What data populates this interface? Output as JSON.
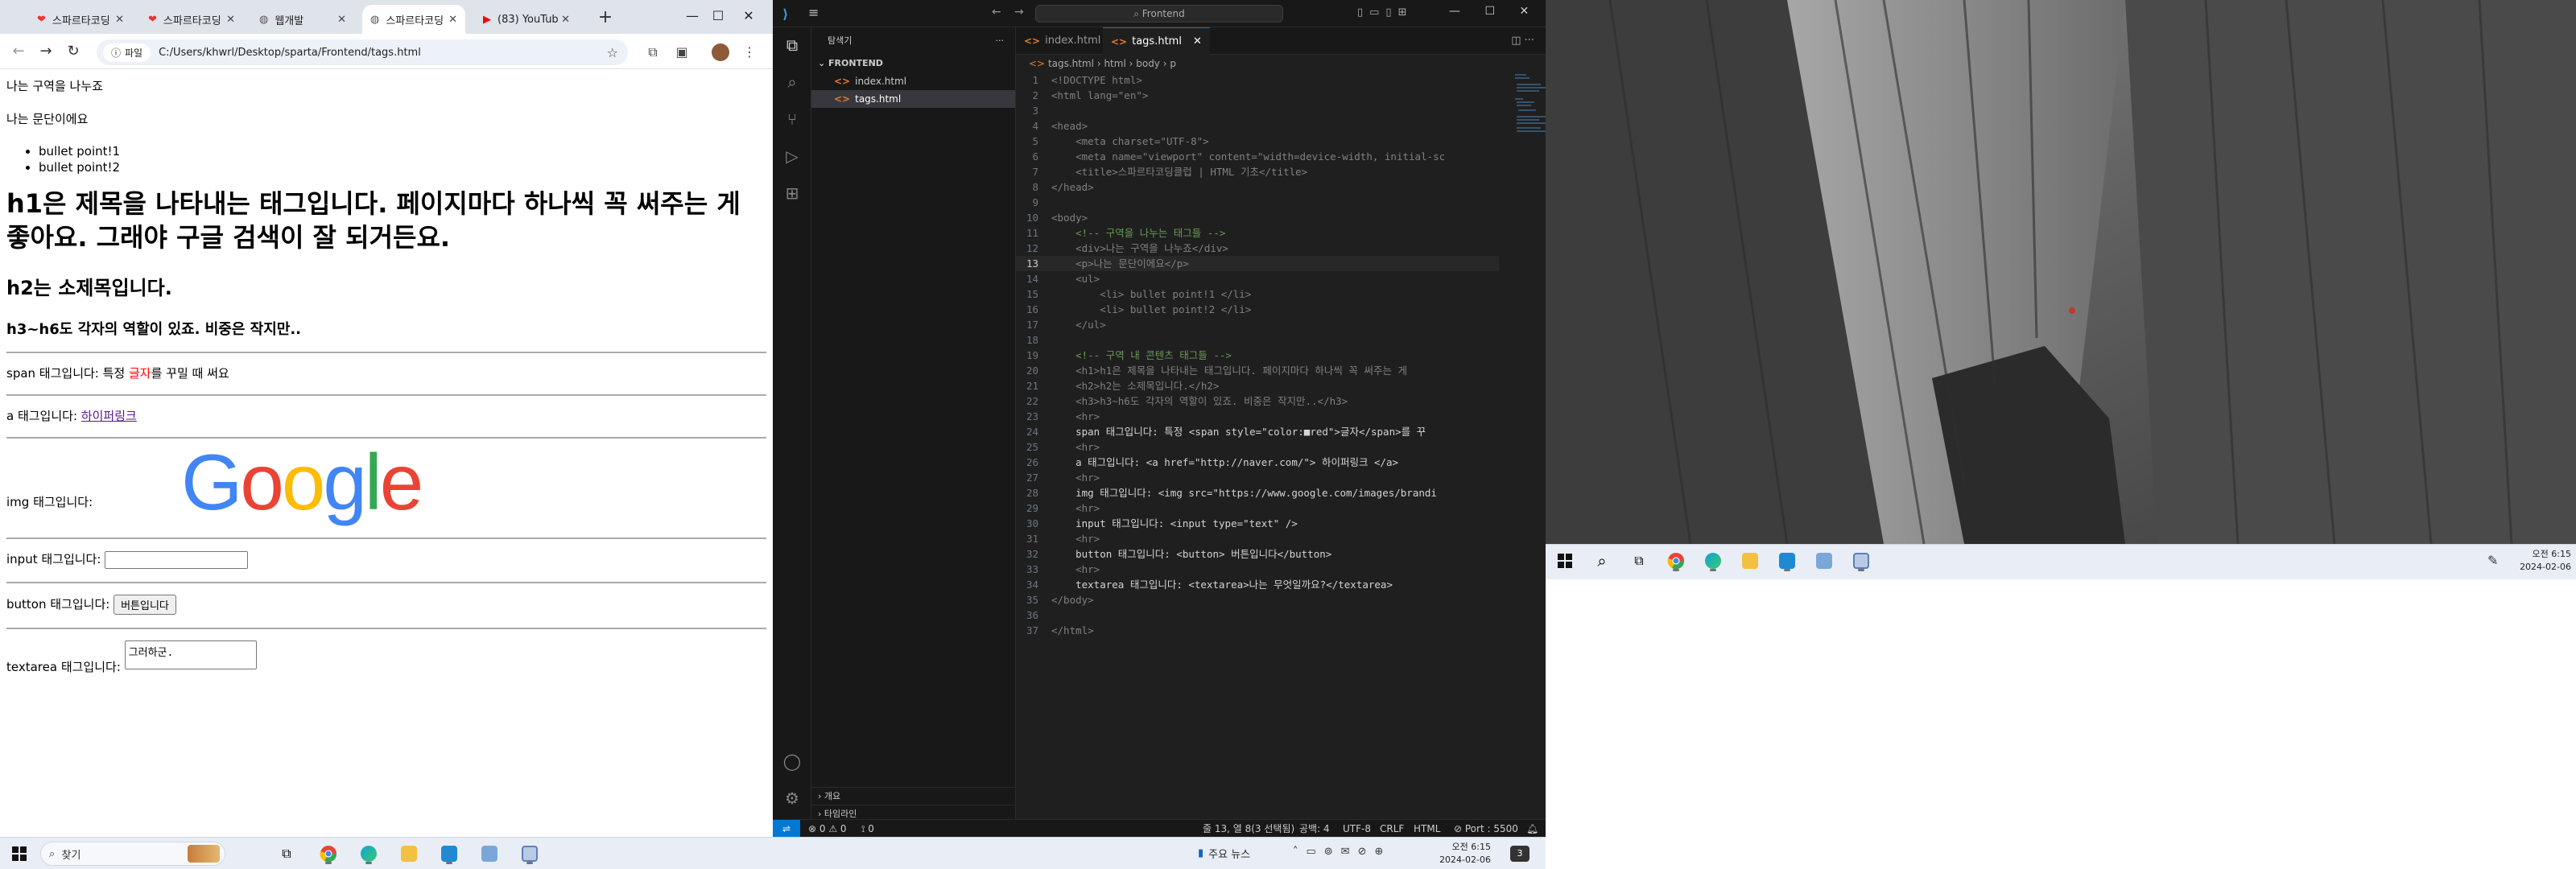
{
  "chrome": {
    "tabs": [
      {
        "title": "스파르타코딩"
      },
      {
        "title": "스파르타코딩"
      },
      {
        "title": "웹개발"
      },
      {
        "title": "스파르타코딩"
      },
      {
        "title": "(83) YouTube"
      }
    ],
    "active_tab": 3,
    "address_chip": "파일",
    "url": "C:/Users/khwrl/Desktop/sparta/Frontend/tags.html",
    "page": {
      "section_text": "나는 구역을 나누죠",
      "paragraph": "나는 문단이에요",
      "bullets": [
        "bullet point!1",
        "bullet point!2"
      ],
      "h1": "h1은 제목을 나타내는 태그입니다. 페이지마다 하나씩 꼭 써주는 게 좋아요. 그래야 구글 검색이 잘 되거든요.",
      "h2": "h2는 소제목입니다.",
      "h3": "h3~h6도 각자의 역할이 있죠. 비중은 작지만..",
      "span_prefix": "span 태그입니다: 특정 ",
      "span_red": "글자",
      "span_suffix": "를 꾸밀 때 써요",
      "a_prefix": "a 태그입니다: ",
      "a_link": "하이퍼링크",
      "img_label": "img 태그입니다:",
      "google_logo": "Google",
      "input_label": "input 태그입니다:",
      "button_label": "button 태그입니다:",
      "button_text": "버튼입니다",
      "textarea_label": "textarea 태그입니다:",
      "textarea_value": "그러하군."
    }
  },
  "vscode": {
    "search": "Frontend",
    "explorer_title": "탐색기",
    "folder": "FRONTEND",
    "files": [
      "index.html",
      "tags.html"
    ],
    "selected_file": "tags.html",
    "outline": "개요",
    "timeline": "타임라인",
    "tabs": [
      "index.html",
      "tags.html"
    ],
    "breadcrumb": [
      "tags.html",
      "html",
      "body",
      "p"
    ],
    "code_lines": [
      "<!DOCTYPE html>",
      "<html lang=\"en\">",
      "",
      "<head>",
      "    <meta charset=\"UTF-8\">",
      "    <meta name=\"viewport\" content=\"width=device-width, initial-sc",
      "    <title>스파르타코딩클럽 | HTML 기초</title>",
      "</head>",
      "",
      "<body>",
      "    <!-- 구역을 나누는 태그들 -->",
      "    <div>나는 구역을 나누죠</div>",
      "    <p>나는 문단이에요</p>",
      "    <ul>",
      "        <li> bullet point!1 </li>",
      "        <li> bullet point!2 </li>",
      "    </ul>",
      "",
      "    <!-- 구역 내 콘텐츠 태그들 -->",
      "    <h1>h1은 제목을 나타내는 태그입니다. 페이지마다 하나씩 꼭 써주는 게",
      "    <h2>h2는 소제목입니다.</h2>",
      "    <h3>h3~h6도 각자의 역할이 있죠. 비중은 작지만..</h3>",
      "    <hr>",
      "    span 태그입니다: 특정 <span style=\"color:■red\">글자</span>를 꾸",
      "    <hr>",
      "    a 태그입니다: <a href=\"http://naver.com/\"> 하이퍼링크 </a>",
      "    <hr>",
      "    img 태그입니다: <img src=\"https://www.google.com/images/brandi",
      "    <hr>",
      "    input 태그입니다: <input type=\"text\" />",
      "    <hr>",
      "    button 태그입니다: <button> 버튼입니다</button>",
      "    <hr>",
      "    textarea 태그입니다: <textarea>나는 무엇일까요?</textarea>",
      "</body>",
      "",
      "</html>"
    ],
    "current_line": 13,
    "status": {
      "errors": "0",
      "warnings": "0",
      "ports": "0",
      "position": "줄 13, 열 8(3 선택됨)",
      "spaces": "공백: 4",
      "encoding": "UTF-8",
      "eol": "CRLF",
      "language": "HTML",
      "port": "Port : 5500"
    }
  },
  "taskbar": {
    "search": "찾기",
    "weather": "주요 뉴스",
    "time": "오전 6:15",
    "date": "2024-02-06",
    "notif_count": "3"
  },
  "taskbar2": {
    "time": "오전 6:15",
    "date": "2024-02-06"
  },
  "colors": {
    "vscode_bg": "#1f1f1f",
    "vscode_accent": "#0078d4",
    "chrome_tabstrip": "#dfe3ea",
    "taskbar": "#e9eef6"
  }
}
